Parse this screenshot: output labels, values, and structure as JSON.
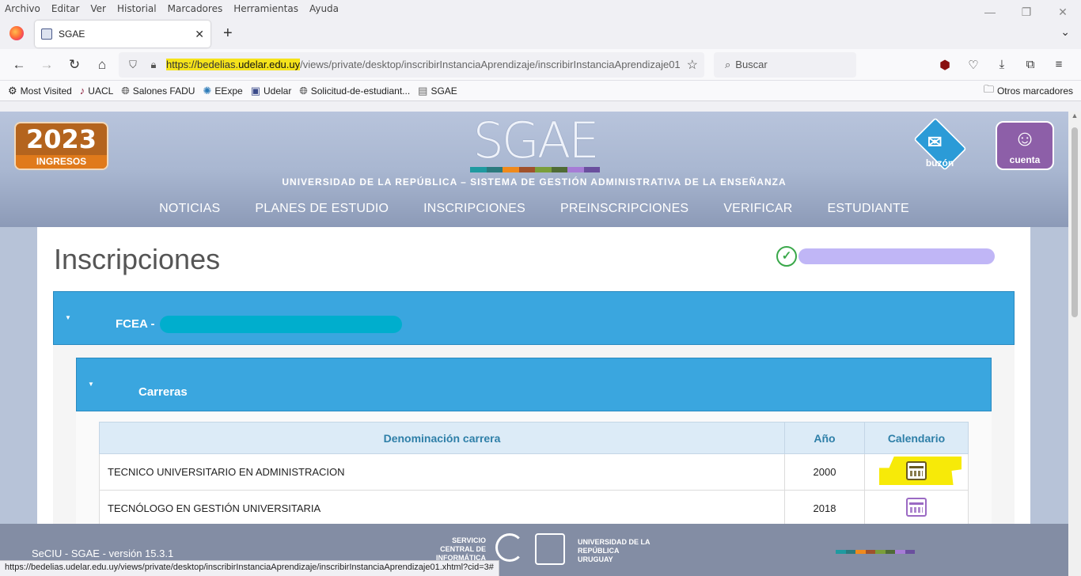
{
  "menubar": [
    "Archivo",
    "Editar",
    "Ver",
    "Historial",
    "Marcadores",
    "Herramientas",
    "Ayuda"
  ],
  "tab": {
    "title": "SGAE"
  },
  "urlbar": {
    "prefix": "https://bedelias.",
    "domain": "udelar.edu.uy",
    "path": "/views/private/desktop/inscribirInstanciaAprendizaje/inscribirInstanciaAprendizaje01.xhtml?cid=3#"
  },
  "search": {
    "placeholder": "Buscar"
  },
  "bookmarks": {
    "items": [
      {
        "label": "Most Visited",
        "icon": "gear-icon"
      },
      {
        "label": "UACL",
        "icon": "violin-icon"
      },
      {
        "label": "Salones FADU",
        "icon": "globe-icon"
      },
      {
        "label": "EExpe",
        "icon": "seal-icon"
      },
      {
        "label": "Udelar",
        "icon": "udelar-icon"
      },
      {
        "label": "Solicitud-de-estudiant...",
        "icon": "globe-icon"
      },
      {
        "label": "SGAE",
        "icon": "sgae-icon"
      }
    ],
    "other": "Otros marcadores"
  },
  "site": {
    "badge_year": "2023",
    "badge_sub": "INGRESOS",
    "logo": "SGAE",
    "tagline": "UNIVERSIDAD DE LA REPÚBLICA – SISTEMA DE GESTIÓN ADMINISTRATIVA DE LA ENSEÑANZA",
    "buzon": "buzón",
    "cuenta": "cuenta",
    "strip_colors": [
      "#1f9aa0",
      "#2b7a7e",
      "#f08a1c",
      "#a0512b",
      "#7a9e3a",
      "#4f6b35",
      "#a67cd6",
      "#6a4f9e"
    ]
  },
  "nav": [
    "NOTICIAS",
    "PLANES DE ESTUDIO",
    "INSCRIPCIONES",
    "PREINSCRIPCIONES",
    "VERIFICAR",
    "ESTUDIANTE"
  ],
  "page": {
    "title": "Inscripciones",
    "panel_title": "FCEA -",
    "subpanel_title": "Carreras"
  },
  "table": {
    "headers": [
      "Denominación carrera",
      "Año",
      "Calendario"
    ],
    "rows": [
      {
        "denominacion": "TECNICO UNIVERSITARIO EN ADMINISTRACION",
        "anio": "2000"
      },
      {
        "denominacion": "TECNÓLOGO EN GESTIÓN UNIVERSITARIA",
        "anio": "2018"
      }
    ]
  },
  "footer": {
    "version": "SeCIU - SGAE - versión 15.3.1",
    "seciu": "SERVICIO CENTRAL DE INFORMÁTICA",
    "udelar": "UNIVERSIDAD DE LA REPÚBLICA URUGUAY"
  },
  "statusbar": "https://bedelias.udelar.edu.uy/views/private/desktop/inscribirInstanciaAprendizaje/inscribirInstanciaAprendizaje01.xhtml?cid=3#"
}
